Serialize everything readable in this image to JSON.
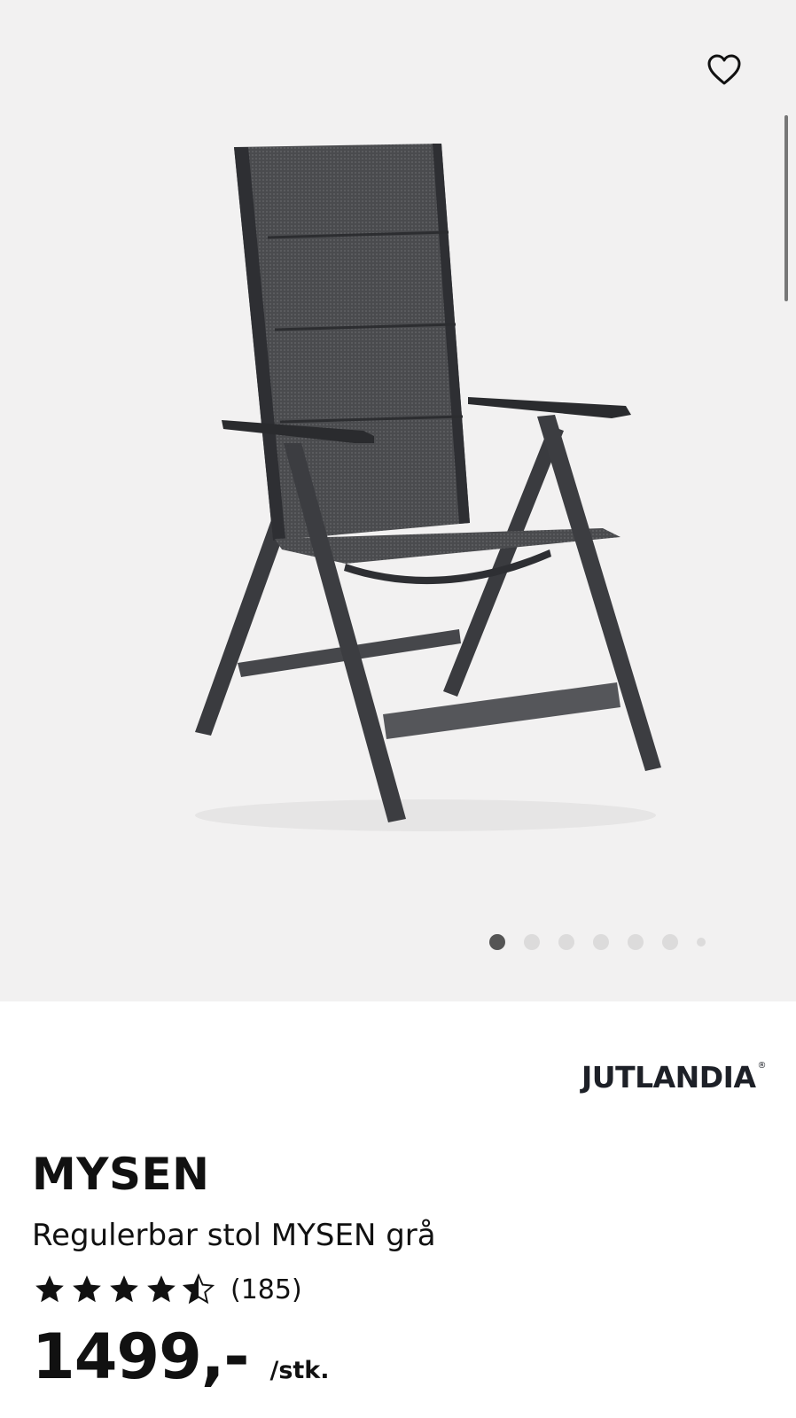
{
  "product": {
    "brand": "JUTLANDIA",
    "brand_mark": "®",
    "name": "MYSEN",
    "description": "Regulerbar stol MYSEN grå",
    "rating": 4.5,
    "rating_max": 5,
    "review_count": "(185)",
    "price": "1499,-",
    "price_unit": "/stk."
  },
  "gallery": {
    "image_count": 7,
    "active_index": 0,
    "icons": {
      "favorite": "heart-outline-icon"
    }
  },
  "colors": {
    "gallery_bg": "#f2f1f1",
    "dot_active": "#555555",
    "dot_inactive": "#dcdbdb",
    "text": "#111111"
  }
}
